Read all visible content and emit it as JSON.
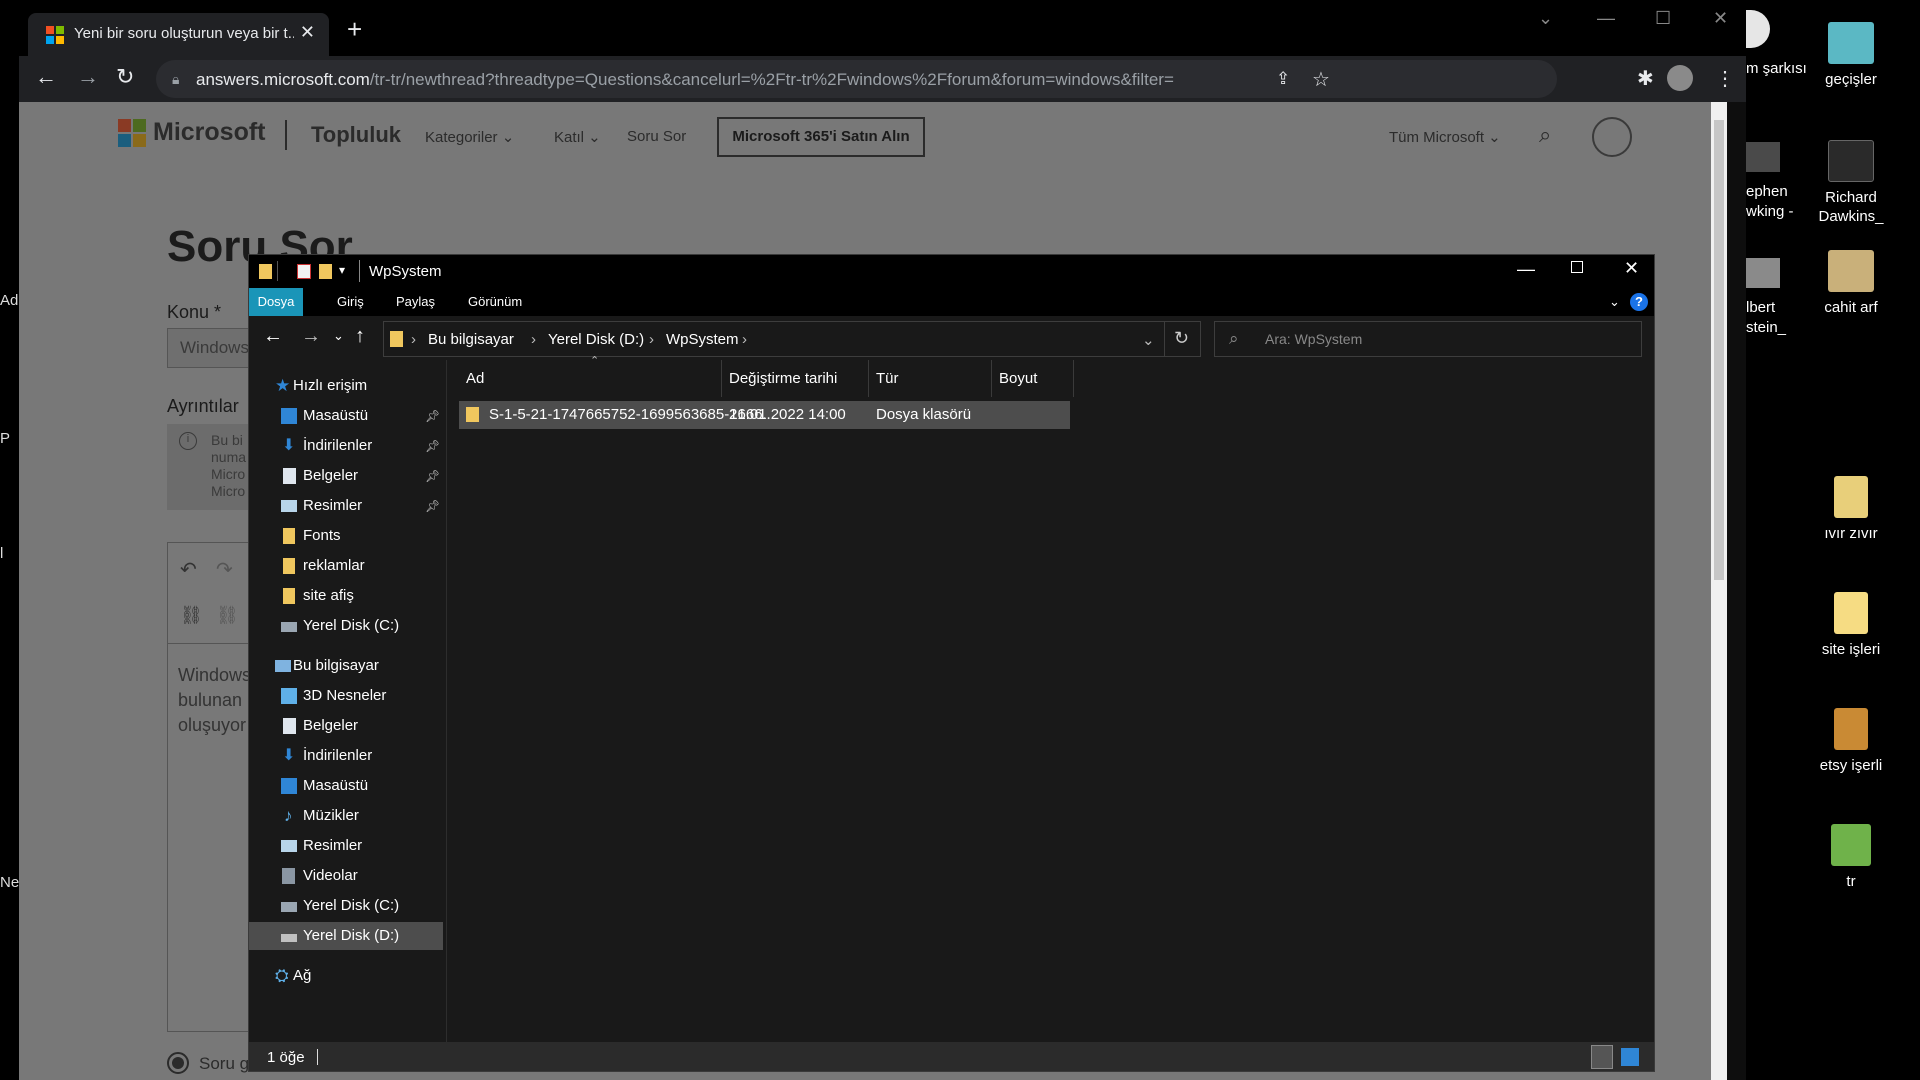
{
  "desktop": {
    "left_partial": [
      "Ad",
      "P",
      "l",
      "Ne"
    ],
    "partial_icons": [
      {
        "line1": "m şarkısı",
        "line2": ""
      },
      {
        "line1": "ephen",
        "line2": "wking -"
      },
      {
        "line1": "lbert",
        "line2": "stein_"
      }
    ],
    "icons": [
      {
        "label1": "geçişler",
        "label2": "",
        "color": "#5bb8c4"
      },
      {
        "label1": "Richard",
        "label2": "Dawkins_",
        "color": "#2a2a2a"
      },
      {
        "label1": "cahit arf",
        "label2": "",
        "color": "#c9b07a"
      },
      {
        "label1": "ıvır zıvır",
        "label2": "",
        "color": "#e8cf7a"
      },
      {
        "label1": "site işleri",
        "label2": "",
        "color": "#f6dc83"
      },
      {
        "label1": "etsy işerli",
        "label2": "",
        "color": "#c98a34"
      },
      {
        "label1": "tr",
        "label2": "",
        "color": "#6fb24a"
      }
    ]
  },
  "browser": {
    "tab_title": "Yeni bir soru oluşturun veya bir t...",
    "tab_close": "✕",
    "new_tab": "+",
    "url_domain": "answers.microsoft.com",
    "url_path": "/tr-tr/newthread?threadtype=Questions&cancelurl=%2Ftr-tr%2Fwindows%2Fforum&forum=windows&filter="
  },
  "page": {
    "brand": "Microsoft",
    "community": "Topluluk",
    "nav": [
      "Kategoriler",
      "Katıl",
      "Soru Sor"
    ],
    "buy_button": "Microsoft 365'i Satın Alın",
    "all_ms": "Tüm Microsoft",
    "title": "Soru Sor",
    "konu_label": "Konu *",
    "konu_value": "Windows",
    "details_label": "Ayrıntılar",
    "info_lines": [
      "Bu bi",
      "numa",
      "Micro",
      "Micro"
    ],
    "body_lines": [
      "Windows",
      "bulunan",
      "oluşuyor"
    ],
    "radio_label": "Soru g"
  },
  "explorer": {
    "title": "WpSystem",
    "ribbon_tabs": [
      "Dosya",
      "Giriş",
      "Paylaş",
      "Görünüm"
    ],
    "breadcrumb": [
      "Bu bilgisayar",
      "Yerel Disk (D:)",
      "WpSystem"
    ],
    "search_placeholder": "Ara: WpSystem",
    "quick_access": {
      "header": "Hızlı erişim",
      "items": [
        "Masaüstü",
        "İndirilenler",
        "Belgeler",
        "Resimler",
        "Fonts",
        "reklamlar",
        "site afiş",
        "Yerel Disk (C:)"
      ]
    },
    "this_pc": {
      "header": "Bu bilgisayar",
      "items": [
        "3D Nesneler",
        "Belgeler",
        "İndirilenler",
        "Masaüstü",
        "Müzikler",
        "Resimler",
        "Videolar",
        "Yerel Disk (C:)",
        "Yerel Disk (D:)"
      ]
    },
    "network": "Ağ",
    "columns": [
      "Ad",
      "Değiştirme tarihi",
      "Tür",
      "Boyut"
    ],
    "rows": [
      {
        "name": "S-1-5-21-1747665752-1699563685-1666...",
        "date": "21.01.2022 14:00",
        "type": "Dosya klasörü",
        "size": ""
      }
    ],
    "status": "1 öğe"
  }
}
